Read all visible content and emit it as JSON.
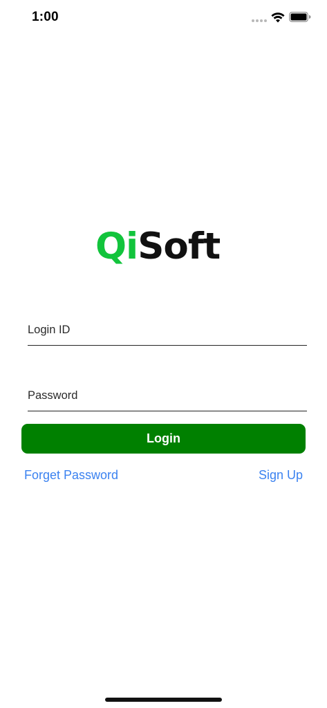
{
  "status_bar": {
    "time": "1:00",
    "wifi_icon": "wifi-icon",
    "battery_icon": "battery-icon",
    "signal_icon": "signal-dots-icon"
  },
  "logo": {
    "part1": "Qi",
    "part2": "Soft",
    "color_part1": "#12c43c",
    "color_part2": "#111111"
  },
  "form": {
    "login_id_placeholder": "Login ID",
    "login_id_value": "",
    "password_placeholder": "Password",
    "password_value": ""
  },
  "actions": {
    "login_label": "Login",
    "login_color": "#008000",
    "forget_password_label": "Forget Password",
    "sign_up_label": "Sign Up",
    "link_color": "#3b82f0"
  }
}
